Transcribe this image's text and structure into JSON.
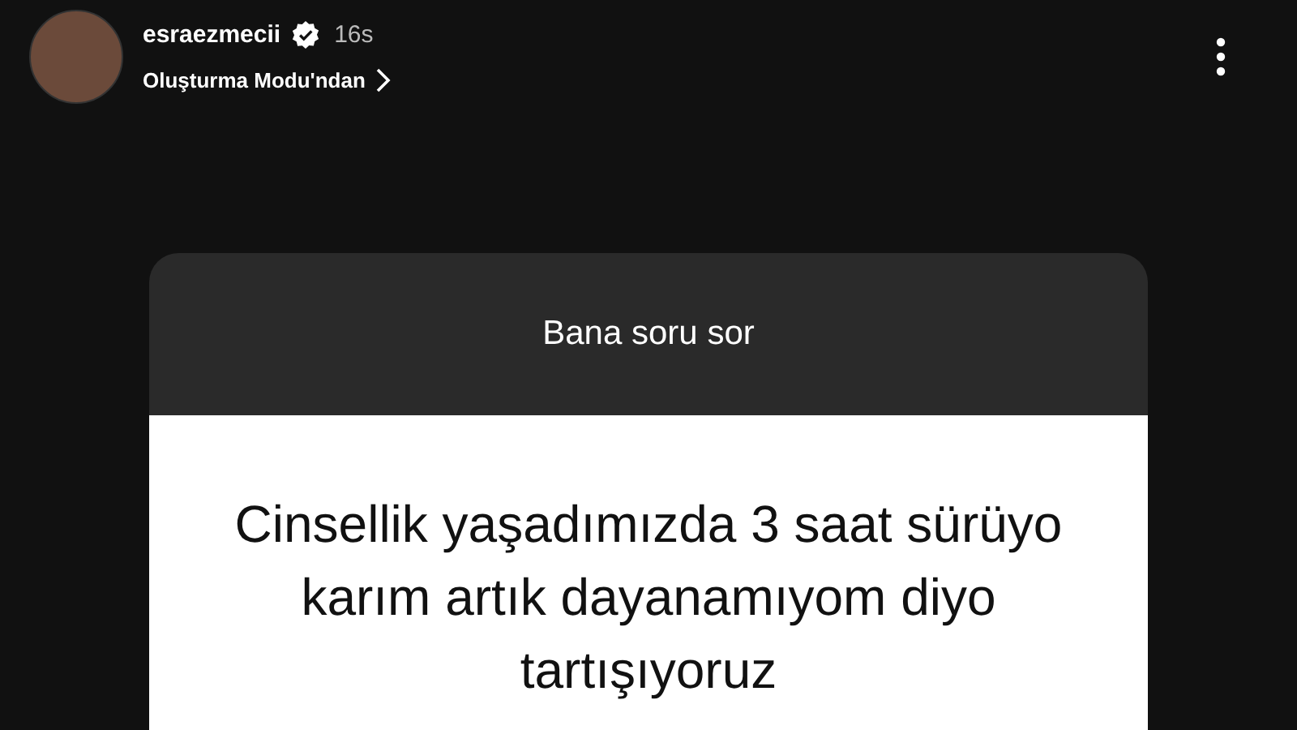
{
  "header": {
    "username": "esraezmecii",
    "verified": true,
    "time": "16s",
    "subtitle": "Oluşturma Modu'ndan"
  },
  "question_card": {
    "title": "Bana soru sor",
    "question": "Cinsellik yaşadımızda 3 saat sürüyo karım artık dayanamıyom diyo tartışıyoruz"
  }
}
